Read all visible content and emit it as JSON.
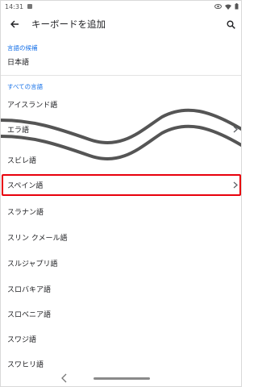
{
  "status_bar": {
    "time": "14:31"
  },
  "app_bar": {
    "title": "キーボードを追加"
  },
  "suggested_section": {
    "header": "言語の候補",
    "items": [
      {
        "label": "日本語"
      }
    ]
  },
  "all_section": {
    "header": "すべての言語",
    "items": [
      {
        "label": "アイスランド語",
        "has_chevron": false
      },
      {
        "label": "エラ語",
        "has_chevron": true
      },
      {
        "label": "スビレ語",
        "has_chevron": false
      },
      {
        "label": "スペイン語",
        "has_chevron": true,
        "highlighted": true
      },
      {
        "label": "スラナン語",
        "has_chevron": false
      },
      {
        "label": "スリン クメール語",
        "has_chevron": false
      },
      {
        "label": "スルジャプリ語",
        "has_chevron": false
      },
      {
        "label": "スロバキア語",
        "has_chevron": false
      },
      {
        "label": "スロベニア語",
        "has_chevron": false
      },
      {
        "label": "スワジ語",
        "has_chevron": false
      },
      {
        "label": "スワヒリ語",
        "has_chevron": false
      }
    ]
  },
  "colors": {
    "accent": "#1a73e8",
    "highlight_border": "#e8000c",
    "wave_stroke": "#555555"
  },
  "icons": [
    "back-arrow-icon",
    "search-icon",
    "chevron-right-icon",
    "nav-back-icon"
  ]
}
